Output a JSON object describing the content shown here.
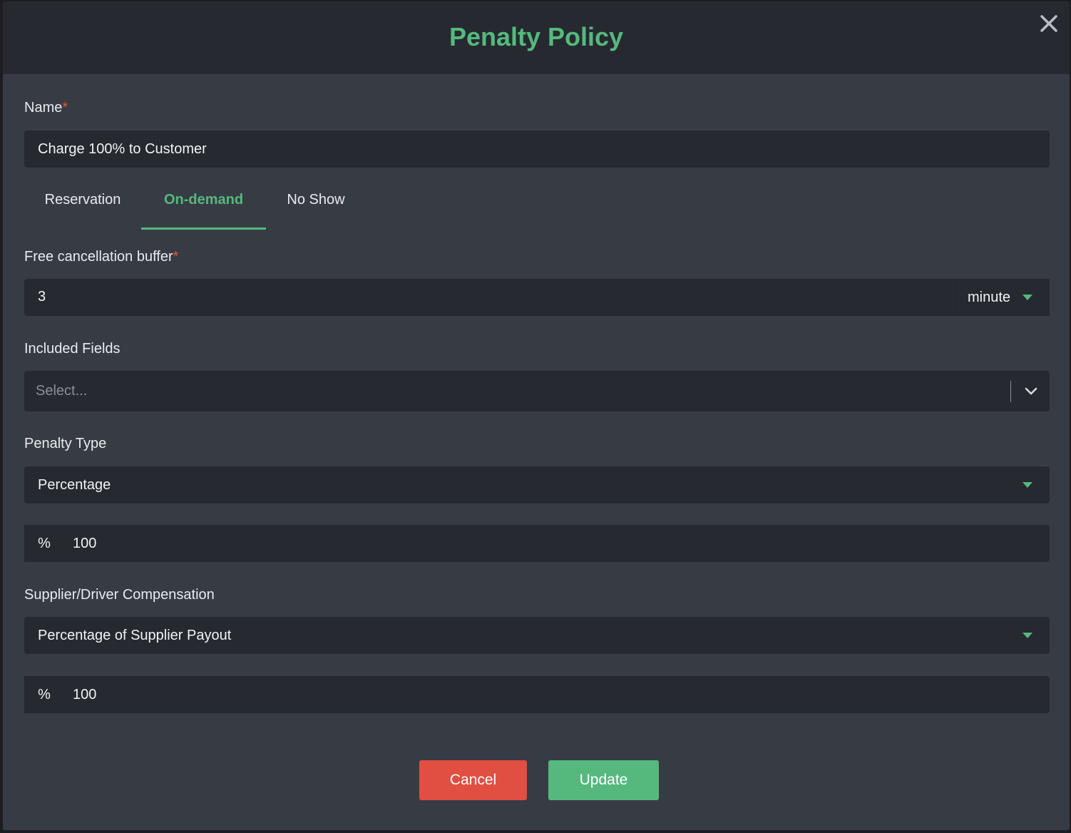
{
  "modal": {
    "title": "Penalty Policy",
    "close_icon": "close-icon"
  },
  "name_field": {
    "label": "Name",
    "required_mark": "*",
    "value": "Charge 100% to Customer"
  },
  "tabs": [
    {
      "label": "Reservation",
      "active": false
    },
    {
      "label": "On-demand",
      "active": true
    },
    {
      "label": "No Show",
      "active": false
    }
  ],
  "buffer_field": {
    "label": "Free cancellation buffer",
    "required_mark": "*",
    "value": "3",
    "unit": "minute"
  },
  "included_fields": {
    "label": "Included Fields",
    "placeholder": "Select..."
  },
  "penalty_type": {
    "label": "Penalty Type",
    "value": "Percentage",
    "prefix": "%",
    "amount": "100"
  },
  "compensation": {
    "label": "Supplier/Driver Compensation",
    "value": "Percentage of Supplier Payout",
    "prefix": "%",
    "amount": "100"
  },
  "actions": {
    "cancel_label": "Cancel",
    "update_label": "Update"
  },
  "colors": {
    "accent": "#55b97d",
    "danger": "#e04f42",
    "required": "#e0533f",
    "panel": "#373b44",
    "input": "#262930"
  }
}
